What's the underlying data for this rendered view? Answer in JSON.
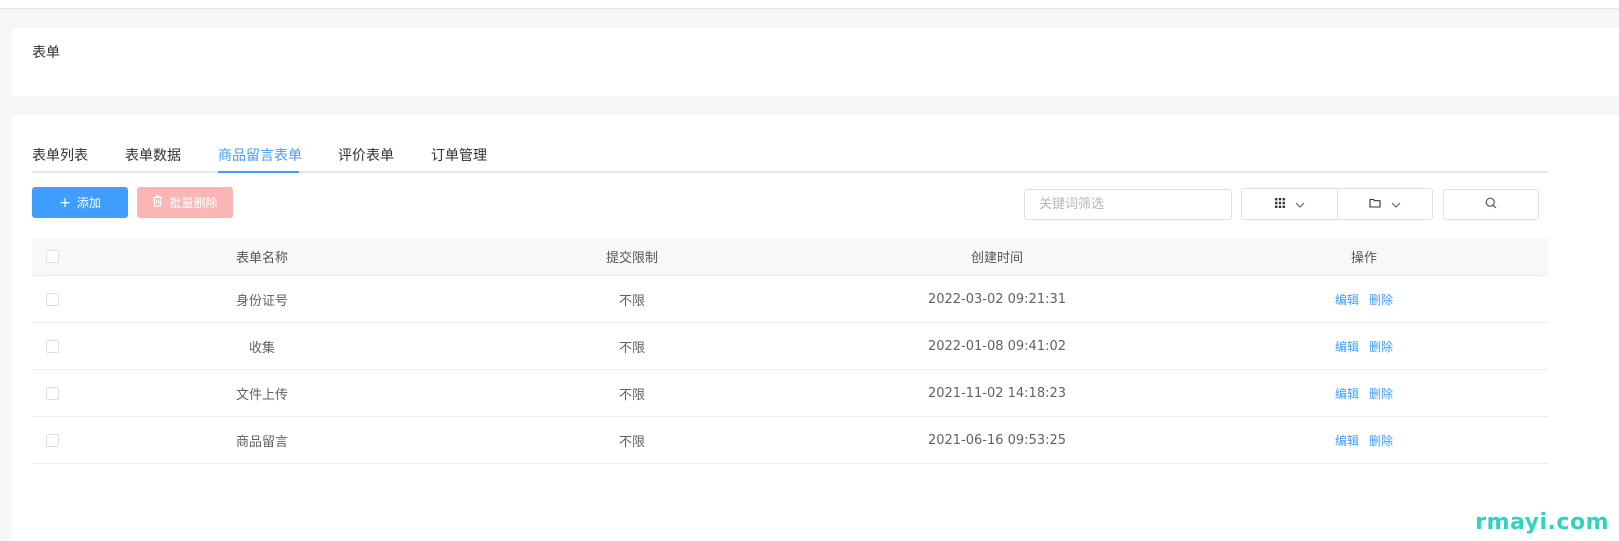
{
  "page": {
    "title": "表单"
  },
  "tabs": [
    {
      "label": "表单列表",
      "active": false
    },
    {
      "label": "表单数据",
      "active": false
    },
    {
      "label": "商品留言表单",
      "active": true
    },
    {
      "label": "评价表单",
      "active": false
    },
    {
      "label": "订单管理",
      "active": false
    }
  ],
  "toolbar": {
    "add_label": "添加",
    "batch_delete_label": "批量删除",
    "search_placeholder": "关键词筛选"
  },
  "table": {
    "headers": {
      "name": "表单名称",
      "limit": "提交限制",
      "created": "创建时间",
      "actions": "操作"
    },
    "rows": [
      {
        "name": "身份证号",
        "limit": "不限",
        "created": "2022-03-02 09:21:31",
        "edit": "编辑",
        "delete": "删除"
      },
      {
        "name": "收集",
        "limit": "不限",
        "created": "2022-01-08 09:41:02",
        "edit": "编辑",
        "delete": "删除"
      },
      {
        "name": "文件上传",
        "limit": "不限",
        "created": "2021-11-02 14:18:23",
        "edit": "编辑",
        "delete": "删除"
      },
      {
        "name": "商品留言",
        "limit": "不限",
        "created": "2021-06-16 09:53:25",
        "edit": "编辑",
        "delete": "删除"
      }
    ]
  },
  "watermark": "rmayi.com",
  "colors": {
    "primary": "#409eff",
    "danger_light": "#fab6b6",
    "watermark": "#2fd3c0"
  }
}
